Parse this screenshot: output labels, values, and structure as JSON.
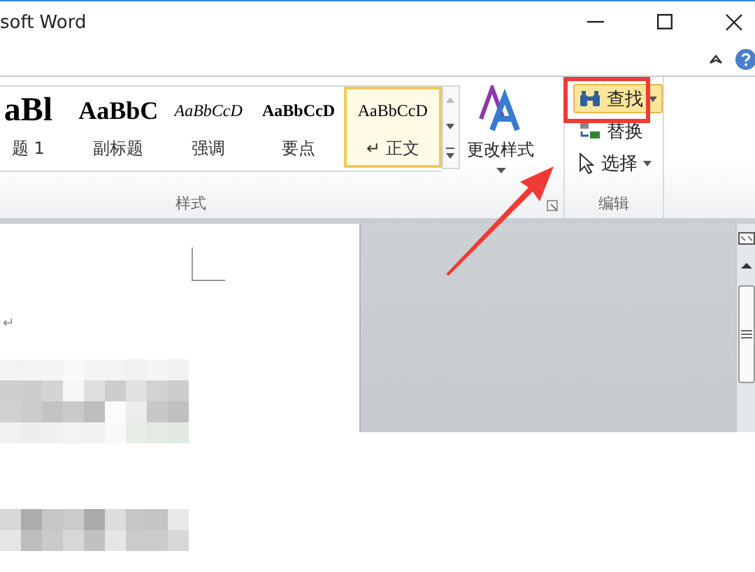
{
  "window": {
    "title": "soft Word"
  },
  "ribbon": {
    "styles": {
      "label": "样式",
      "items": [
        {
          "preview": "aBl",
          "name": "题 1",
          "kind": "heading",
          "selected": false
        },
        {
          "preview": "AaBbC",
          "name": "副标题",
          "kind": "subtitle",
          "selected": false
        },
        {
          "preview": "AaBbCcD",
          "name": "强调",
          "kind": "emphasis",
          "selected": false
        },
        {
          "preview": "AaBbCcD",
          "name": "要点",
          "kind": "strong",
          "selected": false
        },
        {
          "preview": "AaBbCcD",
          "name": "↵ 正文",
          "kind": "normal",
          "selected": true
        }
      ]
    },
    "change_styles": "更改样式",
    "editing": {
      "label": "编辑",
      "items": [
        {
          "label": "查找",
          "kind": "find",
          "highlighted": true,
          "dropdown": true
        },
        {
          "label": "替换",
          "kind": "replace",
          "highlighted": false,
          "dropdown": false
        },
        {
          "label": "选择",
          "kind": "select",
          "highlighted": false,
          "dropdown": true
        }
      ]
    }
  },
  "document": {
    "paragraph_mark": "↵"
  }
}
